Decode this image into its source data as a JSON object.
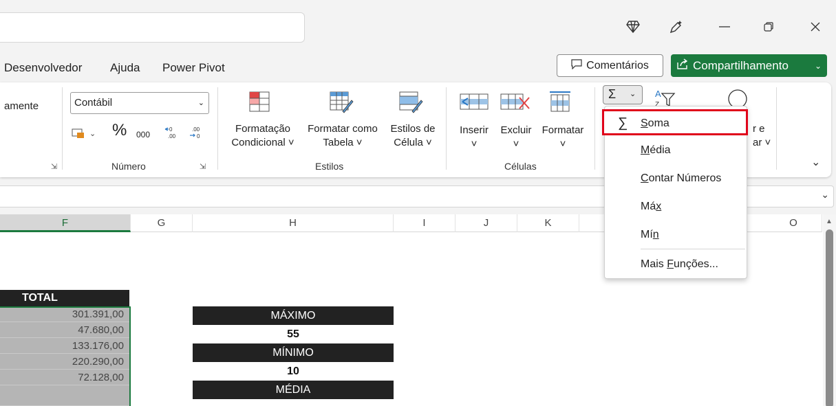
{
  "titlebar": {
    "icons": [
      "diamond-icon",
      "pen-sparkle-icon",
      "minimize-icon",
      "restore-icon",
      "close-icon"
    ]
  },
  "menu": {
    "items": [
      "Desenvolvedor",
      "Ajuda",
      "Power Pivot"
    ],
    "comments_label": "Comentários",
    "share_label": "Compartilhamento"
  },
  "ribbon": {
    "cut_text": "amente",
    "number_format": "Contábil",
    "percent": "%",
    "thousands": "000",
    "group_numero": "Número",
    "group_estilos": "Estilos",
    "group_celulas": "Células",
    "cond_format_line1": "Formatação",
    "cond_format_line2": "Condicional",
    "format_table_line1": "Formatar como",
    "format_table_line2": "Tabela",
    "cell_styles_line1": "Estilos de",
    "cell_styles_line2": "Célula",
    "insert": "Inserir",
    "delete": "Excluir",
    "format": "Formatar",
    "sort_partial_1": "r e",
    "sort_partial_2": "ar"
  },
  "autosum_menu": {
    "items": [
      {
        "label": "Soma",
        "underline": "S"
      },
      {
        "label": "Média",
        "underline": "M"
      },
      {
        "label": "Contar Números",
        "underline": "C"
      },
      {
        "label": "Máx",
        "underline": "x"
      },
      {
        "label": "Mín",
        "underline": "n"
      },
      {
        "label": "Mais Funções...",
        "underline": "F"
      }
    ]
  },
  "grid": {
    "columns": [
      "F",
      "G",
      "H",
      "I",
      "J",
      "K",
      "O"
    ],
    "total_header": "TOTAL",
    "total_values": [
      "301.391,00",
      "47.680,00",
      "133.176,00",
      "220.290,00",
      "72.128,00"
    ],
    "stats": {
      "max_label": "MÁXIMO",
      "max_value": "55",
      "min_label": "MÍNIMO",
      "min_value": "10",
      "avg_label": "MÉDIA"
    }
  },
  "colors": {
    "accent_green": "#1b7a3e",
    "highlight_red": "#e0001a"
  }
}
